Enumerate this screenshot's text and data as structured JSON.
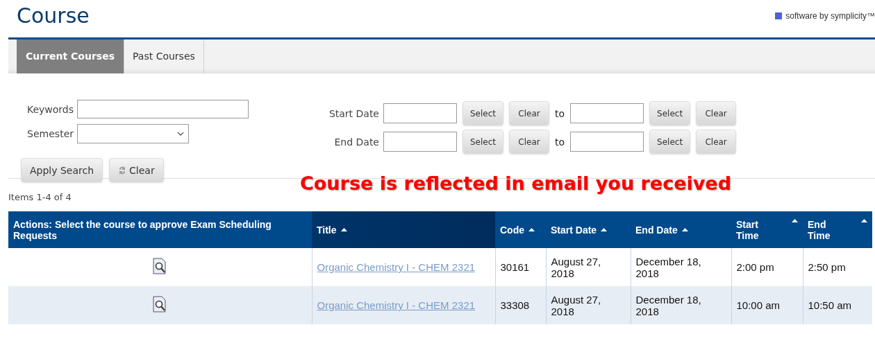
{
  "page_title": "Course",
  "brand": "software by symplicity™",
  "tabs": [
    {
      "label": "Current Courses",
      "selected": true
    },
    {
      "label": "Past Courses",
      "selected": false
    }
  ],
  "search": {
    "keywords_label": "Keywords",
    "semester_label": "Semester",
    "date_rows": [
      {
        "label": "Start Date",
        "select": "Select",
        "clear": "Clear",
        "to": "to",
        "select2": "Select",
        "clear2": "Clear"
      },
      {
        "label": "End Date",
        "select": "Select",
        "clear": "Clear",
        "to": "to",
        "select2": "Select",
        "clear2": "Clear"
      }
    ],
    "apply": "Apply Search",
    "clear": "Clear"
  },
  "annotation": "Course is reflected in email you received",
  "items_count": "Items 1-4 of 4",
  "table": {
    "columns": [
      {
        "label": "Actions: Select the course to approve Exam Scheduling Requests",
        "sortable": false,
        "sorted": false
      },
      {
        "label": "Title",
        "sortable": true,
        "sorted": true
      },
      {
        "label": "Code",
        "sortable": true,
        "sorted": false
      },
      {
        "label": "Start Date",
        "sortable": true,
        "sorted": false
      },
      {
        "label": "End Date",
        "sortable": true,
        "sorted": false
      },
      {
        "label": "Start Time",
        "sortable": true,
        "sorted": false
      },
      {
        "label": "End Time",
        "sortable": true,
        "sorted": false
      }
    ],
    "rows": [
      {
        "title": "Organic Chemistry I - CHEM 2321",
        "code": "30161",
        "start_date": "August 27, 2018",
        "end_date": "December 18, 2018",
        "start_time": "2:00 pm",
        "end_time": "2:50 pm"
      },
      {
        "title": "Organic Chemistry I - CHEM 2321",
        "code": "33308",
        "start_date": "August 27, 2018",
        "end_date": "December 18, 2018",
        "start_time": "10:00 am",
        "end_time": "10:50 am"
      }
    ]
  }
}
